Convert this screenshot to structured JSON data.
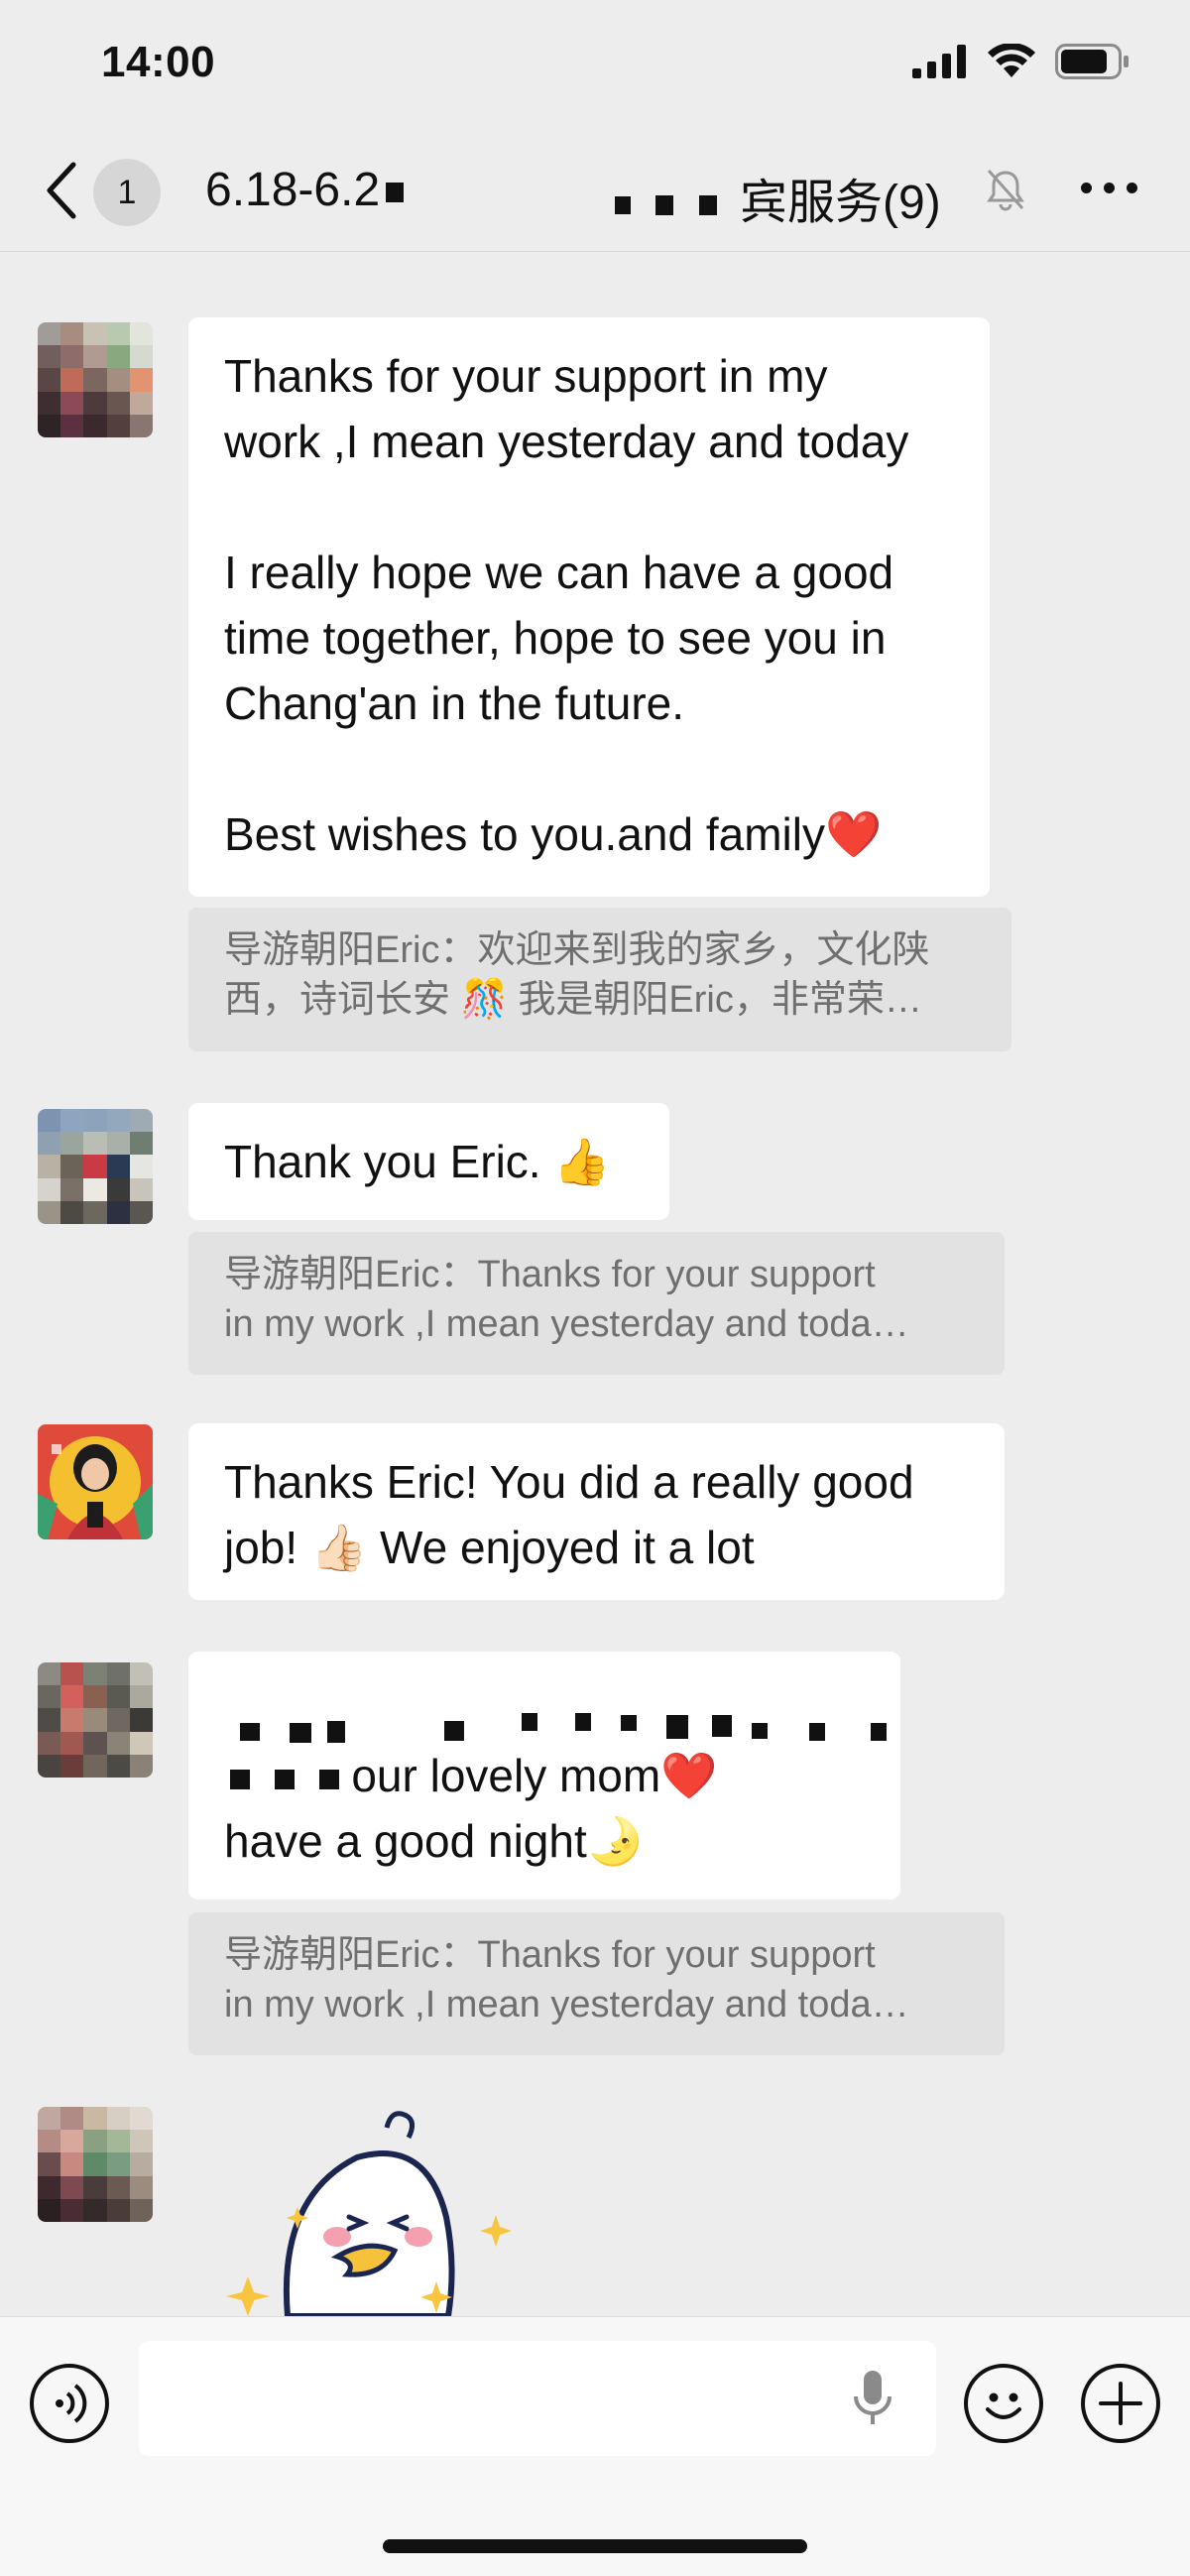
{
  "status_bar": {
    "time": "14:00"
  },
  "nav": {
    "back_count": "1",
    "title_left": "6.18-6.2",
    "title_right": "宾服务",
    "member_count": "(9)"
  },
  "messages": [
    {
      "text": "Thanks for your support in my\nwork ,I mean yesterday and today\n\nI really hope we can have a good\ntime together, hope to see you in\nChang'an in the future.\n\nBest wishes to you.and family❤️",
      "quote_line1": "导游朝阳Eric：欢迎来到我的家乡，文化陕",
      "quote_line2": "西，诗词长安 🎊 我是朝阳Eric，非常荣…"
    },
    {
      "text": "Thank you Eric. 👍",
      "quote_line1": "导游朝阳Eric：Thanks for your support",
      "quote_line2": "in my work ,I mean yesterday and toda…"
    },
    {
      "text": "Thanks Eric! You did a really good\njob! 👍🏻 We enjoyed it a lot"
    },
    {
      "text_line2": " our lovely mom❤️",
      "text_line3": "have a good night🌛",
      "quote_line1": "导游朝阳Eric：Thanks for your support",
      "quote_line2": "in my work ,I mean yesterday and toda…"
    }
  ],
  "colors": {
    "background": "#ededed",
    "bubble": "#ffffff",
    "quote": "#e2e2e2",
    "heart": "#f04a6a"
  }
}
